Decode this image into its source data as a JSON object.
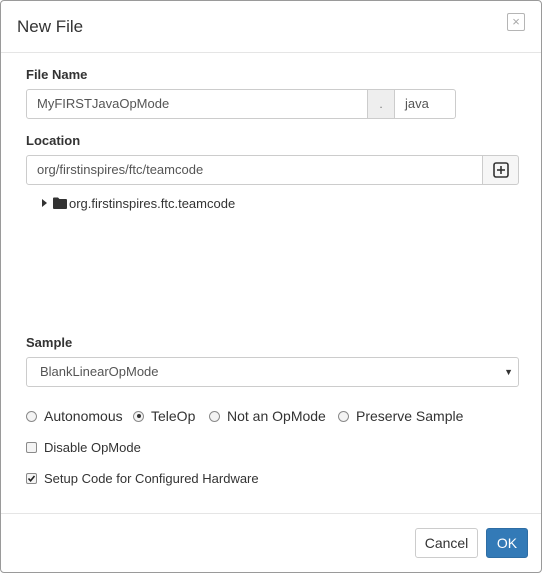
{
  "dialog": {
    "title": "New File",
    "close_symbol": "×"
  },
  "file_name": {
    "label": "File Name",
    "value": "MyFIRSTJavaOpMode",
    "dot": ".",
    "extension": "java"
  },
  "location": {
    "label": "Location",
    "value": "org/firstinspires/ftc/teamcode",
    "add_folder_icon": "plus-square-icon",
    "tree": [
      {
        "label": "org.firstinspires.ftc.teamcode",
        "icon": "folder-icon",
        "expanded": false
      }
    ]
  },
  "sample": {
    "label": "Sample",
    "selected": "BlankLinearOpMode"
  },
  "opmode_types": [
    {
      "label": "Autonomous",
      "selected": false
    },
    {
      "label": "TeleOp",
      "selected": true
    },
    {
      "label": "Not an OpMode",
      "selected": false
    },
    {
      "label": "Preserve Sample",
      "selected": false
    }
  ],
  "options": {
    "disable_opmode": {
      "label": "Disable OpMode",
      "checked": false
    },
    "setup_hardware": {
      "label": "Setup Code for Configured Hardware",
      "checked": true
    }
  },
  "buttons": {
    "cancel": "Cancel",
    "ok": "OK"
  },
  "colors": {
    "primary": "#337ab7",
    "border": "#cccccc",
    "addon_bg": "#eeeeee"
  }
}
